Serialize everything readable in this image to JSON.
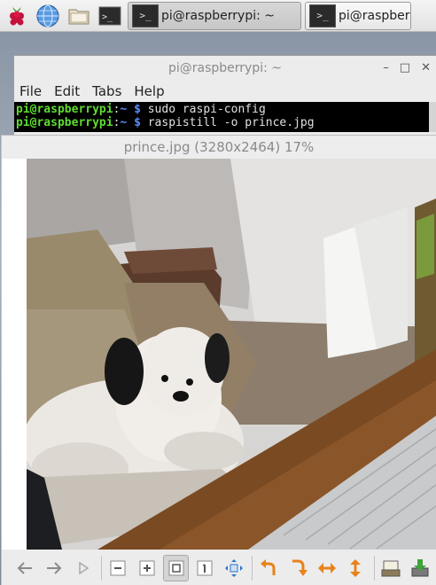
{
  "taskbar": {
    "menu_icon": "raspberry-icon",
    "browser_icon": "globe-icon",
    "files_icon": "folder-icon",
    "terminal_icon": "terminal-icon",
    "tasks": [
      {
        "label": "pi@raspberrypi: ~",
        "active": true
      },
      {
        "label": "pi@raspberrypi: ~",
        "active": false
      }
    ],
    "term_glyph": ">_"
  },
  "terminal": {
    "title": "pi@raspberrypi: ~",
    "window_controls": {
      "minimize": "–",
      "maximize": "□",
      "close": "✕"
    },
    "menu": [
      "File",
      "Edit",
      "Tabs",
      "Help"
    ],
    "lines": [
      {
        "user": "pi@raspberrypi",
        "sep": ":",
        "dir": "~",
        "sigil": "$",
        "cmd": "sudo raspi-config"
      },
      {
        "user": "pi@raspberrypi",
        "sep": ":",
        "dir": "~",
        "sigil": "$",
        "cmd": "raspistill -o prince.jpg"
      }
    ]
  },
  "viewer": {
    "title": "prince.jpg (3280x2464) 17%",
    "toolbar": [
      {
        "name": "back-icon",
        "group": 1
      },
      {
        "name": "forward-icon",
        "group": 1
      },
      {
        "name": "play-icon",
        "group": 1
      },
      {
        "name": "zoom-out-icon",
        "group": 2
      },
      {
        "name": "zoom-in-icon",
        "group": 2
      },
      {
        "name": "fit-window-icon",
        "group": 2,
        "pressed": true
      },
      {
        "name": "original-size-icon",
        "group": 2
      },
      {
        "name": "fullscreen-icon",
        "group": 2
      },
      {
        "name": "rotate-left-icon",
        "group": 3
      },
      {
        "name": "rotate-right-icon",
        "group": 3
      },
      {
        "name": "flip-horizontal-icon",
        "group": 3
      },
      {
        "name": "flip-vertical-icon",
        "group": 3
      },
      {
        "name": "open-file-icon",
        "group": 4
      },
      {
        "name": "save-file-icon",
        "group": 4
      }
    ]
  },
  "colors": {
    "prompt_green": "#5fdc2f",
    "path_blue": "#5a8cff",
    "accent_orange": "#e8821a",
    "accent_blue": "#2c74c8"
  }
}
